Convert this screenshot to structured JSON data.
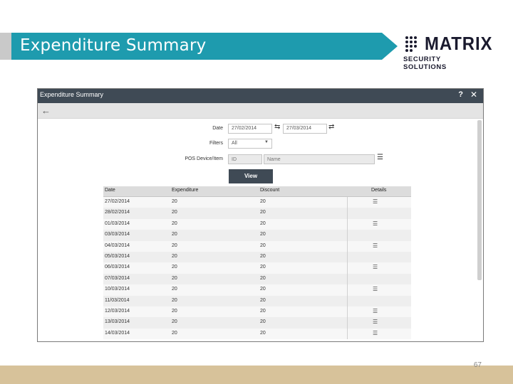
{
  "slide": {
    "title": "Expenditure Summary",
    "page_number": "67",
    "banner_color": "#1e9bae",
    "footer_color": "#d7c29a"
  },
  "logo": {
    "word": "MATRIX",
    "subtitle": "SECURITY SOLUTIONS"
  },
  "window": {
    "title": "Expenditure Summary",
    "help_icon": "question-mark-icon",
    "close_icon": "close-icon",
    "back_icon": "back-arrow-icon"
  },
  "form": {
    "date_label": "Date",
    "date_from": "27/02/2014",
    "date_to": "27/03/2014",
    "filters_label": "Filters",
    "filters_value": "All",
    "pos_label": "POS Device/Item",
    "pos_id_placeholder": "ID",
    "pos_name_placeholder": "Name",
    "view_label": "View"
  },
  "table": {
    "headers": [
      "Date",
      "Expenditure",
      "Discount",
      "Details"
    ],
    "rows": [
      {
        "date": "27/02/2014",
        "expenditure": "20",
        "discount": "20",
        "details": true
      },
      {
        "date": "28/02/2014",
        "expenditure": "20",
        "discount": "20",
        "details": false
      },
      {
        "date": "01/03/2014",
        "expenditure": "20",
        "discount": "20",
        "details": true
      },
      {
        "date": "03/03/2014",
        "expenditure": "20",
        "discount": "20",
        "details": false
      },
      {
        "date": "04/03/2014",
        "expenditure": "20",
        "discount": "20",
        "details": true
      },
      {
        "date": "05/03/2014",
        "expenditure": "20",
        "discount": "20",
        "details": false
      },
      {
        "date": "06/03/2014",
        "expenditure": "20",
        "discount": "20",
        "details": true
      },
      {
        "date": "07/03/2014",
        "expenditure": "20",
        "discount": "20",
        "details": false
      },
      {
        "date": "10/03/2014",
        "expenditure": "20",
        "discount": "20",
        "details": true
      },
      {
        "date": "11/03/2014",
        "expenditure": "20",
        "discount": "20",
        "details": false
      },
      {
        "date": "12/03/2014",
        "expenditure": "20",
        "discount": "20",
        "details": true
      },
      {
        "date": "13/03/2014",
        "expenditure": "20",
        "discount": "20",
        "details": true
      },
      {
        "date": "14/03/2014",
        "expenditure": "20",
        "discount": "20",
        "details": true
      }
    ]
  }
}
